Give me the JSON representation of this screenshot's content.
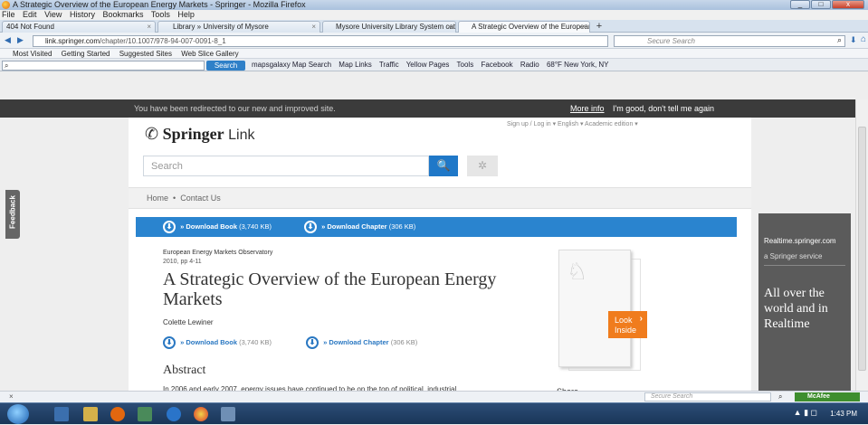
{
  "window": {
    "title": "A Strategic Overview of the European Energy Markets - Springer - Mozilla Firefox",
    "min": "_",
    "max": "□",
    "close": "x"
  },
  "menu": [
    "File",
    "Edit",
    "View",
    "History",
    "Bookmarks",
    "Tools",
    "Help"
  ],
  "tabs": [
    {
      "label": "404 Not Found",
      "close": "×"
    },
    {
      "label": "Library » University of Mysore",
      "close": "×"
    },
    {
      "label": "Mysore University Library System cat...",
      "close": "×"
    },
    {
      "label": "A Strategic Overview of the European...",
      "close": "×"
    }
  ],
  "newtab": "+",
  "nav": {
    "back": "◀",
    "forward": "▶",
    "url_host": "link.springer.com",
    "url_path": "/chapter/10.1007/978-94-007-0091-8_1",
    "search_placeholder": "Secure Search",
    "search_icon": "⌕",
    "download_icon": "⬇",
    "home_icon": "⌂"
  },
  "bookmarks": [
    "Most Visited",
    "Getting Started",
    "Suggested Sites",
    "Web Slice Gallery"
  ],
  "toolbar2": {
    "input_value": "",
    "input_icon": "⌕",
    "search_button": "Search",
    "items": [
      "mapsgalaxy Map Search",
      "Map Links",
      "Traffic",
      "Yellow Pages",
      "Tools",
      "Facebook",
      "Radio",
      "68°F New York, NY"
    ]
  },
  "redirect": {
    "message": "You have been redirected to our new and improved site.",
    "more_info": "More info",
    "dismiss": "I'm good, don't tell me again"
  },
  "header": {
    "top_links": "Sign up / Log in ▾    English ▾    Academic edition ▾",
    "logo_mark": "✆",
    "logo_springer": "Springer",
    "logo_link": "Link",
    "search_placeholder": "Search",
    "search_icon": "🔍",
    "settings_icon": "✲"
  },
  "breadcrumb": {
    "home": "Home",
    "separator": "•",
    "contact": "Contact Us"
  },
  "download_bar": {
    "icon": "⬇",
    "book_label": "» Download Book",
    "book_size": "(3,740 KB)",
    "chapter_label": "» Download Chapter",
    "chapter_size": "(306 KB)"
  },
  "article": {
    "series": "European Energy Markets Observatory",
    "pages": "2010, pp 4-11",
    "title": "A Strategic Overview of the European Energy Markets",
    "author": "Colette Lewiner",
    "abstract_heading": "Abstract",
    "abstract_text": "In 2006 and early 2007, energy issues have continued to be on the top of political, industrial,"
  },
  "cover": {
    "horse_icon": "♘",
    "look_inside": "Look Inside",
    "look_chevron": "›"
  },
  "share_label": "Share",
  "ad": {
    "line1": "Realtime.springer.com",
    "line2": "a Springer service",
    "tagline": "All over the world and in Realtime"
  },
  "feedback_label": "Feedback",
  "statusbar": {
    "close": "×",
    "search_placeholder": "Secure Search",
    "search_icon": "⌕",
    "mcafee": "McAfee"
  },
  "taskbar": {
    "tray_icons": "▲  ▮  ◻",
    "time": "1:43 PM",
    "colors": {
      "start": "#1b5fb0",
      "bar": "#193658"
    }
  }
}
